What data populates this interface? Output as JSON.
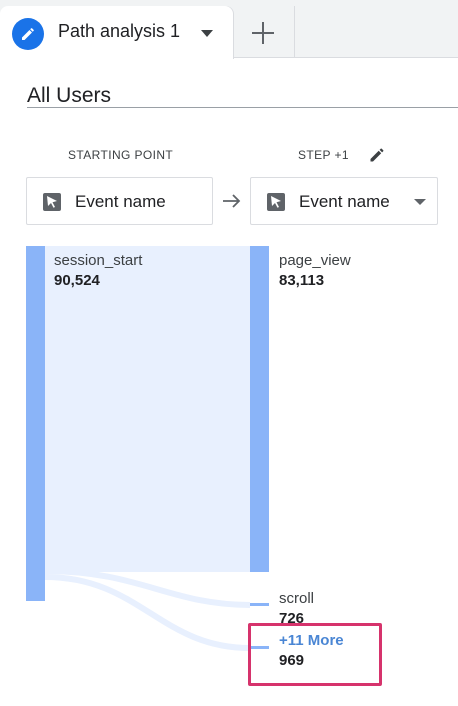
{
  "tabs": {
    "active": {
      "label": "Path analysis 1",
      "icon": "pencil-icon"
    },
    "add_icon": "plus-icon"
  },
  "segment": {
    "title": "All Users"
  },
  "columns": {
    "start": {
      "header": "STARTING POINT",
      "dropdown_value": "Event name"
    },
    "step1": {
      "header": "STEP +1",
      "dropdown_value": "Event name"
    }
  },
  "nodes": {
    "start": [
      {
        "name": "session_start",
        "value": "90,524"
      }
    ],
    "step1": [
      {
        "name": "page_view",
        "value": "83,113"
      },
      {
        "name": "scroll",
        "value": "726"
      },
      {
        "name": "+11 More",
        "value": "969"
      }
    ]
  },
  "colors": {
    "accent": "#1a73e8",
    "node_bar": "#8ab4f8",
    "node_fill": "#e8f0fe",
    "highlight": "#d6336c",
    "more_link": "#4a86d4"
  }
}
